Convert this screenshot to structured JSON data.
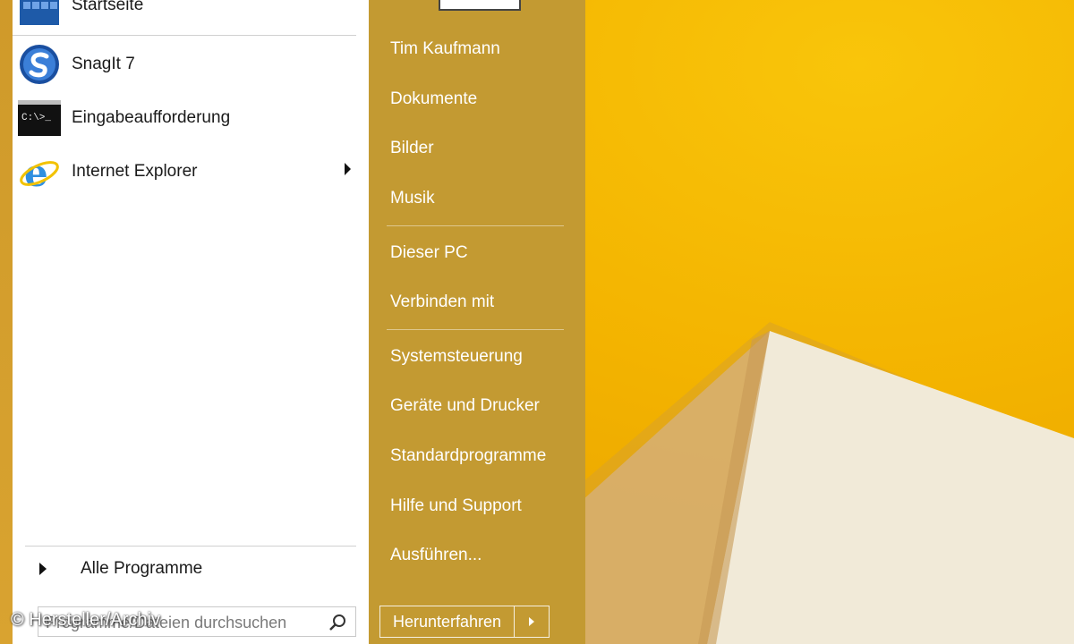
{
  "left_panel": {
    "apps": [
      {
        "label": "Startseite",
        "icon": "start-tiles-icon"
      },
      {
        "label": "SnagIt 7",
        "icon": "snagit-icon"
      },
      {
        "label": "Eingabeaufforderung",
        "icon": "command-prompt-icon",
        "icon_text": "C:\\>_"
      },
      {
        "label": "Internet Explorer",
        "icon": "internet-explorer-icon",
        "has_submenu": true
      }
    ],
    "all_programs_label": "Alle Programme",
    "search": {
      "placeholder": "Programme/Dateien durchsuchen",
      "value": ""
    }
  },
  "right_panel": {
    "items": [
      {
        "label": "Tim Kaufmann"
      },
      {
        "label": "Dokumente"
      },
      {
        "label": "Bilder"
      },
      {
        "label": "Musik"
      },
      {
        "label": "Dieser PC"
      },
      {
        "label": "Verbinden mit"
      },
      {
        "label": "Systemsteuerung"
      },
      {
        "label": "Geräte und Drucker"
      },
      {
        "label": "Standardprogramme"
      },
      {
        "label": "Hilfe und Support"
      },
      {
        "label": "Ausführen..."
      }
    ],
    "shutdown_label": "Herunterfahren"
  },
  "watermark": "© Hersteller/Archiv",
  "colors": {
    "right_panel": "#c39a32",
    "wallpaper": "#f3b300"
  }
}
